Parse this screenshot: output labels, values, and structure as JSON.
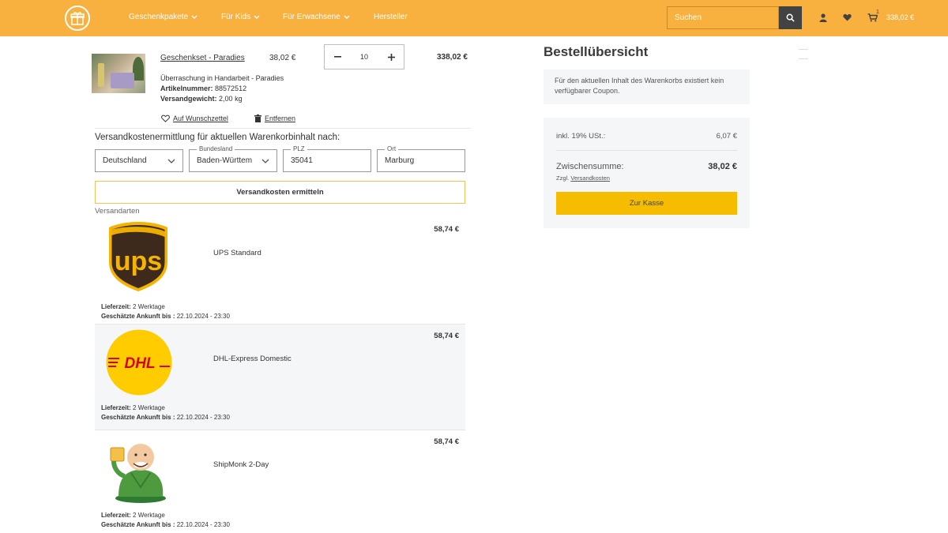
{
  "header": {
    "nav": [
      "Geschenkpakete",
      "Für Kids",
      "Für Erwachsene",
      "Hersteller"
    ],
    "search_placeholder": "Suchen",
    "cart_count": "1",
    "cart_total": "338,02 €"
  },
  "product": {
    "name": "Geschenkset - Paradies",
    "unit_price": "38,02 €",
    "quantity": "10",
    "line_total": "338,02 €",
    "description": "Überraschung in Handarbeit - Paradies",
    "sku_label": "Artikelnummer:",
    "sku": "88572512",
    "weight_label": "Versandgewicht:",
    "weight": "2,00 kg",
    "wishlist_label": "Auf Wunschzettel",
    "remove_label": "Entfernen"
  },
  "shipping_calc": {
    "title": "Versandkostenermittlung für aktuellen Warenkorbinhalt nach:",
    "country": "Deutschland",
    "state_label": "Bundesland",
    "state": "Baden-Württem",
    "zip_label": "PLZ",
    "zip": "35041",
    "city_label": "Ort",
    "city": "Marburg",
    "button": "Versandkosten ermitteln",
    "methods_label": "Versandarten"
  },
  "shipping_methods": [
    {
      "name": "UPS Standard",
      "price": "58,74 €",
      "delivery_label": "Lieferzeit:",
      "delivery": "2 Werktage",
      "arrival_label": "Geschätzte Ankunft bis :",
      "arrival": "22.10.2024 - 23:30",
      "logo": "ups-logo"
    },
    {
      "name": "DHL-Express Domestic",
      "price": "58,74 €",
      "delivery_label": "Lieferzeit:",
      "delivery": "2 Werktage",
      "arrival_label": "Geschätzte Ankunft bis :",
      "arrival": "22.10.2024 - 23:30",
      "logo": "dhl-logo"
    },
    {
      "name": "ShipMonk 2-Day",
      "price": "58,74 €",
      "delivery_label": "Lieferzeit:",
      "delivery": "2 Werktage",
      "arrival_label": "Geschätzte Ankunft bis :",
      "arrival": "22.10.2024 - 23:30",
      "logo": "shipmonk-logo"
    }
  ],
  "summary": {
    "title": "Bestellübersicht",
    "coupon_text": "Für den aktuellen Inhalt des Warenkorbs existiert kein verfügbarer Coupon.",
    "tax_label": "inkl. 19% USt.:",
    "tax_value": "6,07 €",
    "subtotal_label": "Zwischensumme:",
    "subtotal_value": "38,02 €",
    "shipping_note_prefix": "Zzgl.",
    "shipping_note_link": "Versandkosten",
    "checkout_label": "Zur Kasse"
  },
  "colors": {
    "header": "#f8b03e",
    "checkout": "#f5bc00",
    "ups_brown": "#3d2a1c",
    "ups_gold": "#f5b400",
    "dhl_yellow": "#ffcc00",
    "dhl_red": "#d40511"
  }
}
